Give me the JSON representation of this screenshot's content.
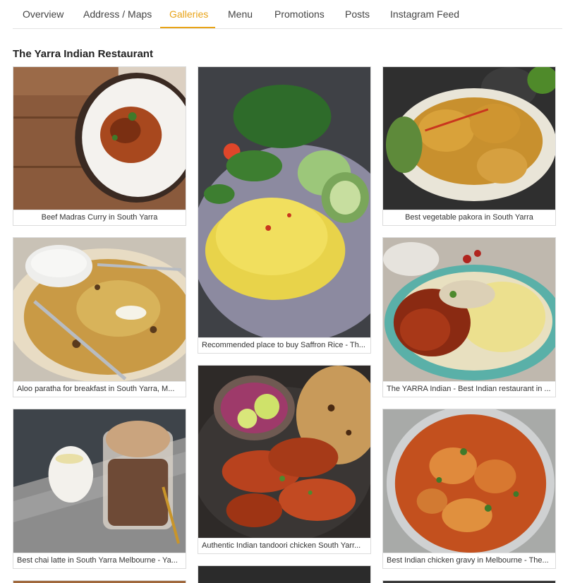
{
  "tabs": [
    {
      "label": "Overview"
    },
    {
      "label": "Address / Maps"
    },
    {
      "label": "Galleries"
    },
    {
      "label": "Menu"
    },
    {
      "label": "Promotions"
    },
    {
      "label": "Posts"
    },
    {
      "label": "Instagram Feed"
    }
  ],
  "active_tab": "Galleries",
  "accent_color": "#e8a317",
  "gallery": {
    "title": "The Yarra Indian Restaurant",
    "items": [
      {
        "caption": "Beef Madras Curry in South Yarra",
        "subject": "curry-plate"
      },
      {
        "caption": "Recommended place to buy Saffron Rice - Th...",
        "subject": "saffron-rice"
      },
      {
        "caption": "Best vegetable pakora in South Yarra",
        "subject": "pakora"
      },
      {
        "caption": "Aloo paratha for breakfast in South Yarra, M...",
        "subject": "paratha"
      },
      {
        "caption": "The YARRA Indian - Best Indian restaurant in ...",
        "subject": "curry-rice"
      },
      {
        "caption": "Best chai latte in South Yarra Melbourne - Ya...",
        "subject": "chai"
      },
      {
        "caption": "Authentic Indian tandoori chicken South Yarr...",
        "subject": "tandoori"
      },
      {
        "caption": "Best Indian chicken gravy in Melbourne - The...",
        "subject": "chicken-gravy"
      }
    ]
  }
}
